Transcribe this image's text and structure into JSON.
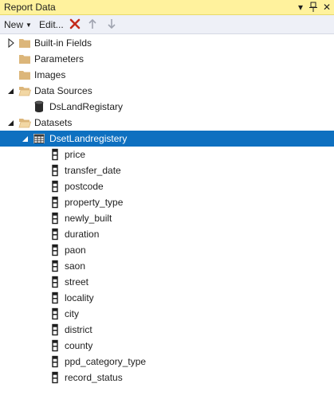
{
  "window": {
    "title": "Report Data",
    "controls": {
      "dropdown": "▾",
      "pin": "📌",
      "close": "✕"
    }
  },
  "toolbar": {
    "new_label": "New",
    "edit_label": "Edit...",
    "delete_icon": "delete-icon",
    "up_icon": "move-up-icon",
    "down_icon": "move-down-icon",
    "delete_color": "#c42b1c",
    "disabled_color": "#a0a4b0"
  },
  "tree": {
    "builtin_fields": "Built-in Fields",
    "parameters": "Parameters",
    "images": "Images",
    "data_sources": "Data Sources",
    "data_source": "DsLandRegistary",
    "datasets": "Datasets",
    "dataset": "DsetLandregistery",
    "fields": [
      "price",
      "transfer_date",
      "postcode",
      "property_type",
      "newly_built",
      "duration",
      "paon",
      "saon",
      "street",
      "locality",
      "city",
      "district",
      "county",
      "ppd_category_type",
      "record_status"
    ]
  },
  "colors": {
    "selection": "#0e70c0",
    "folder": "#dcb67a",
    "titlebar": "#fff29d"
  }
}
